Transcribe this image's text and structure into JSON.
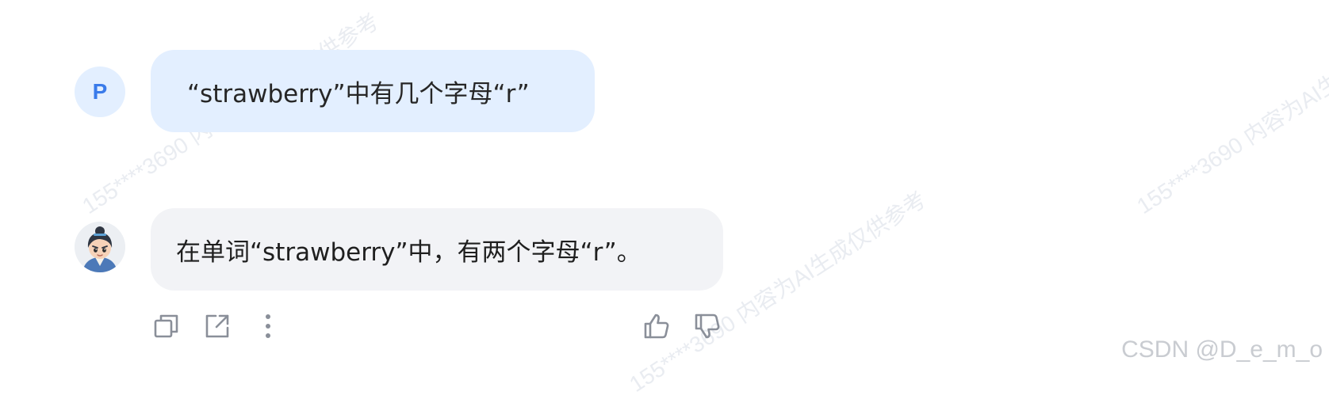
{
  "watermark_text": "155****3690 内容为AI生成仅供参考",
  "user": {
    "avatar_letter": "P",
    "message": "“strawberry”中有几个字母“r”"
  },
  "assistant": {
    "avatar_icon": "character-avatar-icon",
    "message": "在单词“strawberry”中，有两个字母“r”。"
  },
  "actions": {
    "icons": [
      "copy-icon",
      "share-icon",
      "more-icon",
      "thumbs-up-icon",
      "thumbs-down-icon"
    ]
  },
  "footer": {
    "credit": "CSDN @D_e_m_o"
  },
  "colors": {
    "user_bubble": "#e3efff",
    "assistant_bubble": "#f2f3f6",
    "avatar_letter": "#3a7bea",
    "icon_gray": "#8a8f99"
  }
}
